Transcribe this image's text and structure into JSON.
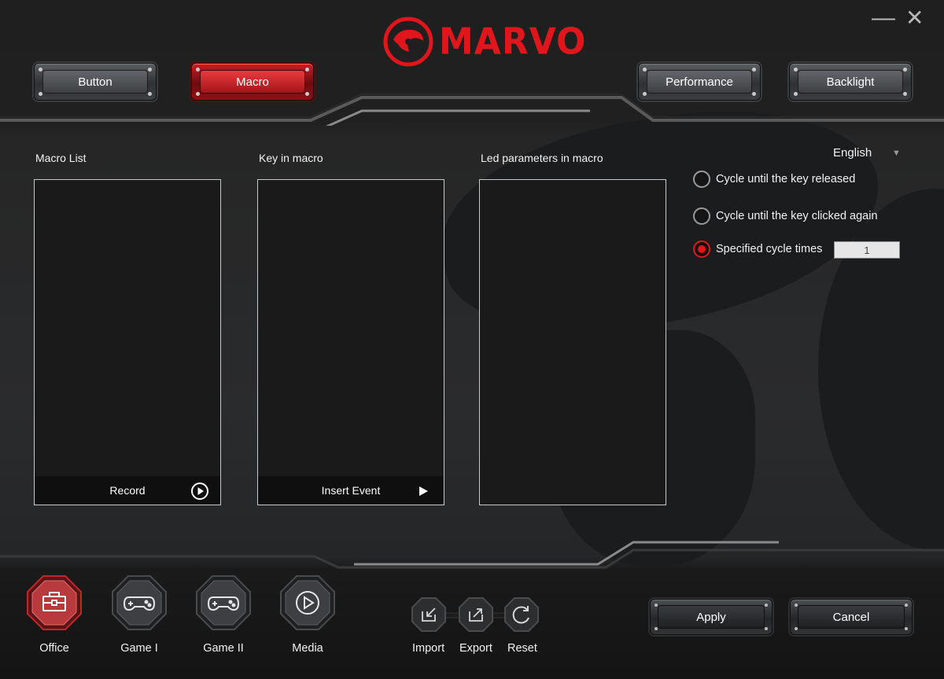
{
  "brand": {
    "name": "MARVO",
    "color": "#e0161c"
  },
  "window": {
    "minimize_glyph": "—",
    "close_glyph": "✕"
  },
  "tabs": [
    {
      "label": "Button",
      "active": false
    },
    {
      "label": "Macro",
      "active": true
    },
    {
      "label": "Performance",
      "active": false
    },
    {
      "label": "Backlight",
      "active": false
    }
  ],
  "macro": {
    "macro_list_label": "Macro List",
    "key_in_macro_label": "Key in macro",
    "led_params_label": "Led parameters in macro",
    "record_label": "Record",
    "insert_event_label": "Insert Event"
  },
  "options": {
    "language": "English",
    "cycle_released": "Cycle until the key released",
    "cycle_clicked": "Cycle until the key clicked again",
    "specified_cycle": "Specified cycle times",
    "cycle_count": "1",
    "selected": "specified"
  },
  "profiles": [
    {
      "label": "Office",
      "icon": "toolbox-icon",
      "active": true
    },
    {
      "label": "Game I",
      "icon": "gamepad-icon",
      "active": false
    },
    {
      "label": "Game II",
      "icon": "gamepad-icon",
      "active": false
    },
    {
      "label": "Media",
      "icon": "play-circle-icon",
      "active": false
    }
  ],
  "tools": {
    "import": "Import",
    "export": "Export",
    "reset": "Reset"
  },
  "actions": {
    "apply": "Apply",
    "cancel": "Cancel"
  }
}
